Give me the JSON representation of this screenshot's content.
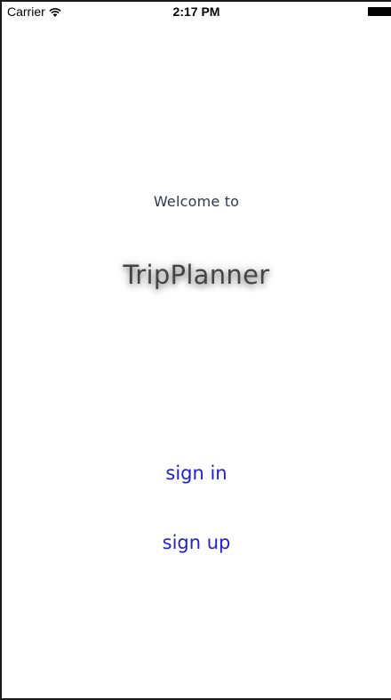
{
  "status_bar": {
    "carrier": "Carrier",
    "time": "2:17 PM",
    "wifi_icon": "wifi-icon",
    "battery_icon": "battery-icon"
  },
  "main": {
    "welcome_text": "Welcome to",
    "app_title": "TripPlanner",
    "sign_in_label": "sign in",
    "sign_up_label": "sign up"
  },
  "colors": {
    "link": "#1f1fd0",
    "title": "#444444",
    "welcome": "#2f3a4a",
    "background": "#ffffff"
  }
}
